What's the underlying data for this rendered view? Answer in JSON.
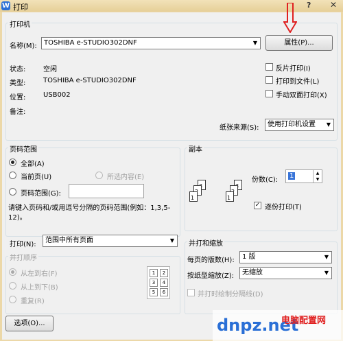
{
  "window": {
    "title": "打印",
    "help": "?",
    "close": "✕",
    "logo_letter": "W"
  },
  "printer": {
    "legend": "打印机",
    "name_label": "名称(M):",
    "name_value": "TOSHIBA e-STUDIO302DNF",
    "properties_button": "属性(P)...",
    "status_label": "状态:",
    "status_value": "空闲",
    "type_label": "类型:",
    "type_value": "TOSHIBA e-STUDIO302DNF",
    "location_label": "位置:",
    "location_value": "USB002",
    "comment_label": "备注:",
    "options": {
      "reverse": {
        "label": "反片打印(I)",
        "checked": false
      },
      "to_file": {
        "label": "打印到文件(L)",
        "checked": false
      },
      "manual_duplex": {
        "label": "手动双面打印(X)",
        "checked": false
      }
    },
    "paper_source_label": "纸张来源(S):",
    "paper_source_value": "使用打印机设置"
  },
  "page_range": {
    "legend": "页码范围",
    "all": "全部(A)",
    "current": "当前页(U)",
    "selection": "所选内容(E)",
    "range": "页码范围(G):",
    "range_value": "",
    "hint": "请键入页码和/或用逗号分隔的页码范围(例如：1,3,5-12)。"
  },
  "copies": {
    "legend": "副本",
    "count_label": "份数(C):",
    "count_value": "1",
    "collate_label": "逐份打印(T)",
    "collate_checked": true
  },
  "print_what": {
    "label": "打印(N):",
    "value": "范围中所有页面"
  },
  "order": {
    "legend": "并打顺序",
    "left_to_right": "从左到右(F)",
    "top_to_bottom": "从上到下(B)",
    "repeat": "重复(R)",
    "grid": [
      "1",
      "2",
      "3",
      "4",
      "5",
      "6"
    ]
  },
  "zoom": {
    "legend": "并打和缩放",
    "pages_per_sheet_label": "每页的版数(H):",
    "pages_per_sheet_value": "1 版",
    "scale_label": "按纸型缩放(Z):",
    "scale_value": "无缩放",
    "draw_borders": "并打时绘制分隔线(D)"
  },
  "footer": {
    "options_button": "选项(O)..."
  },
  "copy_icons": {
    "stack1": [
      "1",
      "2",
      "3"
    ],
    "stack2": [
      "1",
      "2",
      "3"
    ]
  },
  "watermark": {
    "brand": "dnpz.net",
    "cn": "电脑配置网"
  },
  "colors": {
    "title_bar": "#e6cf98",
    "arrow": "#e02020",
    "accent": "#2a6fd6"
  }
}
